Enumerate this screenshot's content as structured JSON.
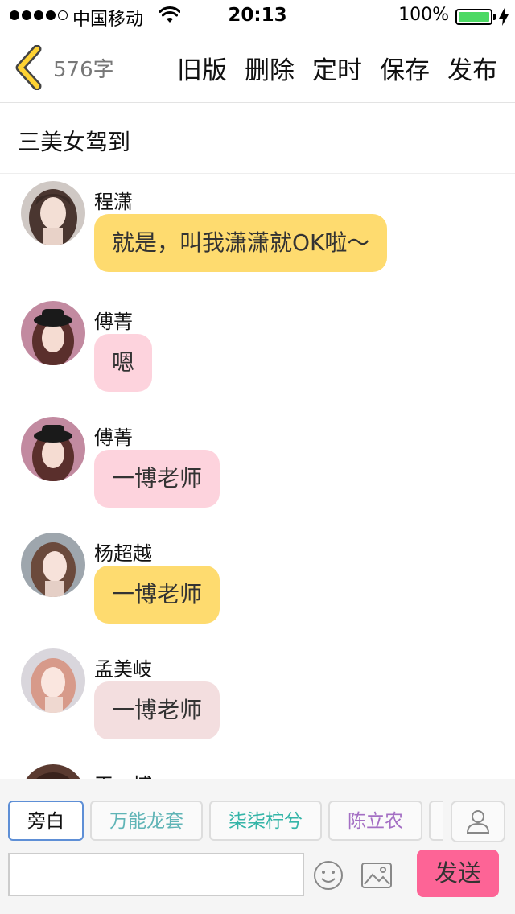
{
  "status_bar": {
    "carrier": "中国移动",
    "time": "20:13",
    "battery_percent": "100%",
    "signal_icon": "signal-dots-icon",
    "wifi_icon": "wifi-icon",
    "battery_icon": "battery-icon",
    "charging_icon": "charging-bolt-icon"
  },
  "nav": {
    "back_icon": "chevron-left-icon",
    "back_color": "#fed233",
    "word_count": "576字",
    "actions": [
      "旧版",
      "删除",
      "定时",
      "保存",
      "发布"
    ]
  },
  "title": "三美女驾到",
  "messages": [
    {
      "sender": "程潇",
      "text": "就是，叫我潇潇就OK啦～",
      "bubble_color": "#fedb6f"
    },
    {
      "sender": "傅菁",
      "text": "嗯",
      "bubble_color": "#fdd3dd"
    },
    {
      "sender": "傅菁",
      "text": "一博老师",
      "bubble_color": "#fdd3dd"
    },
    {
      "sender": "杨超越",
      "text": "一博老师",
      "bubble_color": "#fedb6f"
    },
    {
      "sender": "孟美岐",
      "text": "一博老师",
      "bubble_color": "#f3dedf"
    },
    {
      "sender": "王一博",
      "text": ""
    }
  ],
  "toolbar": {
    "chips": [
      "旁白",
      "万能龙套",
      "柒柒柠兮",
      "陈立农"
    ],
    "person_icon": "person-icon",
    "emoji_icon": "emoji-icon",
    "image_icon": "image-icon",
    "send_label": "发送",
    "send_color": "#fd6496",
    "input_value": ""
  }
}
